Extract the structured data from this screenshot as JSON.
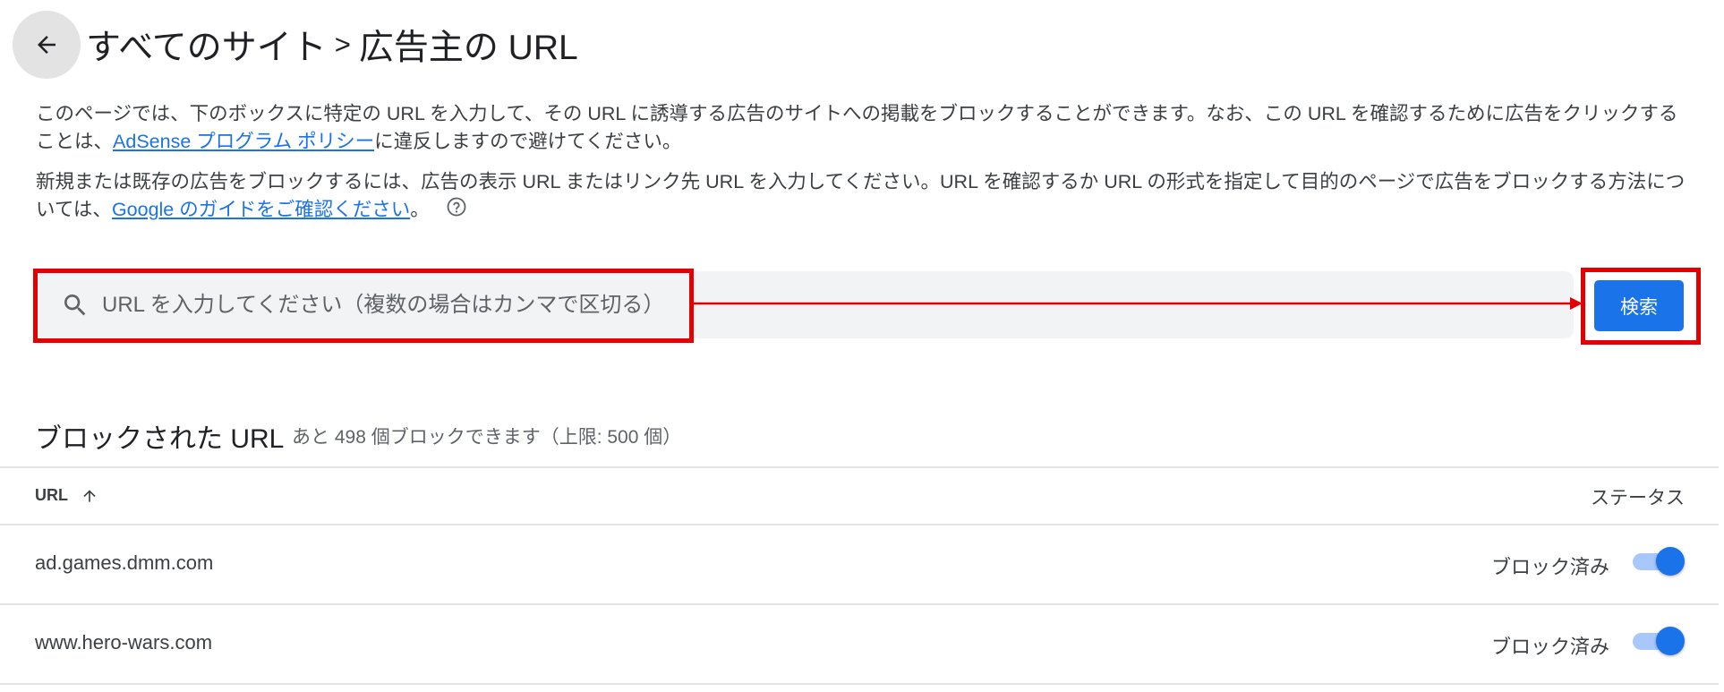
{
  "header": {
    "breadcrumb_parent": "すべてのサイト",
    "separator": ">",
    "title": "広告主の URL"
  },
  "description": {
    "p1_before": "このページでは、下のボックスに特定の URL を入力して、その URL に誘導する広告のサイトへの掲載をブロックすることができます。なお、この URL を確認するために広告をクリックすることは、",
    "p1_link": "AdSense プログラム ポリシー",
    "p1_after": "に違反しますので避けてください。",
    "p2_before": "新規または既存の広告をブロックするには、広告の表示 URL またはリンク先 URL を入力してください。URL を確認するか URL の形式を指定して目的のページで広告をブロックする方法については、",
    "p2_link": "Google のガイドをご確認ください",
    "p2_after": "。"
  },
  "search": {
    "placeholder": "URL を入力してください（複数の場合はカンマで区切る）",
    "value": "",
    "button_label": "検索"
  },
  "blocked": {
    "title": "ブロックされた URL",
    "subtitle": "あと 498 個ブロックできます（上限: 500 個）",
    "columns": {
      "url": "URL",
      "status": "ステータス"
    },
    "rows": [
      {
        "url": "ad.games.dmm.com",
        "status": "ブロック済み",
        "enabled": true
      },
      {
        "url": "www.hero-wars.com",
        "status": "ブロック済み",
        "enabled": true
      }
    ]
  },
  "colors": {
    "accent": "#1a73e8",
    "toggle_track": "#a8c7fa",
    "highlight": "#e30000",
    "search_bg": "#f1f3f4"
  },
  "icons": [
    "back-arrow-icon",
    "help-icon",
    "search-icon",
    "sort-arrow-up-icon",
    "arrow-annotation"
  ]
}
